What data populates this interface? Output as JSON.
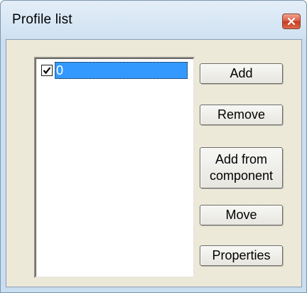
{
  "window": {
    "title": "Profile list"
  },
  "list": {
    "items": [
      {
        "label": "0",
        "checked": true
      }
    ]
  },
  "buttons": {
    "add": "Add",
    "remove": "Remove",
    "add_from_component": "Add from component",
    "move": "Move",
    "properties": "Properties"
  },
  "colors": {
    "selection": "#3399ff",
    "dialog_face": "#ece9d8",
    "frame": "#c9def0",
    "close_button": "#d9563f"
  },
  "icons": {
    "close": "close-x-icon",
    "check": "checkmark-icon"
  }
}
